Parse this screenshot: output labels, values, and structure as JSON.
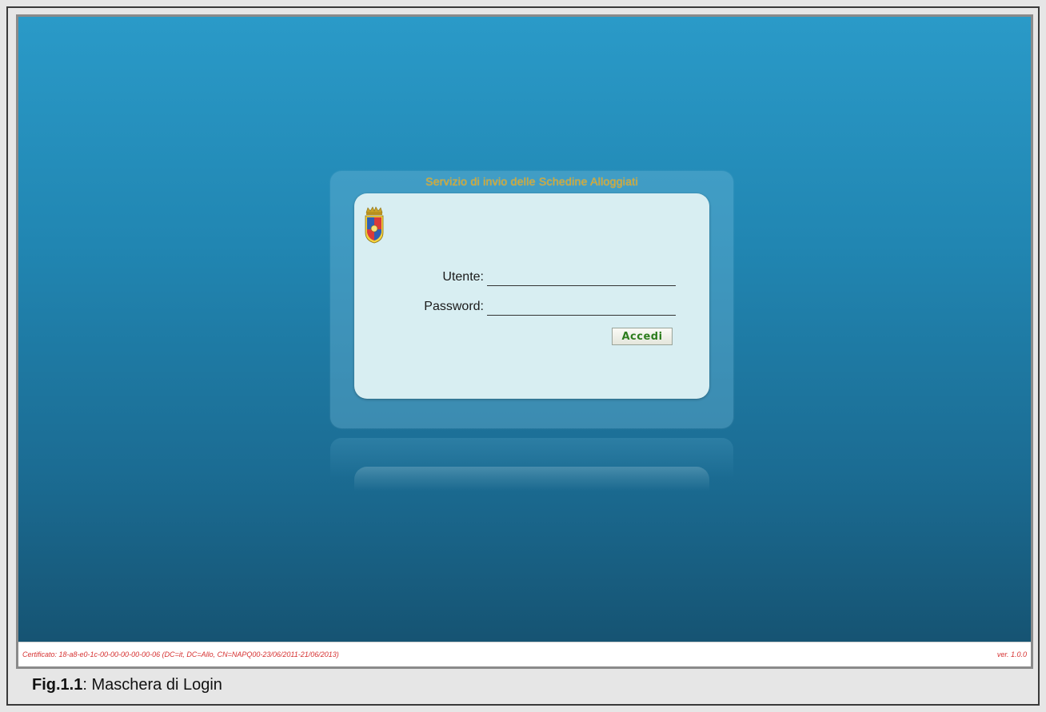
{
  "login": {
    "title": "Servizio di invio delle Schedine Alloggiati",
    "user_label": "Utente:",
    "user_value": "",
    "password_label": "Password:",
    "password_value": "",
    "submit_label": "Accedi"
  },
  "emblem_icon": "polizia-di-stato-emblem-icon",
  "status_bar": {
    "certificate": "Certificato: 18-a8-e0-1c-00-00-00-00-00-06 (DC=it, DC=Allo, CN=NAPQ00-23/06/2011-21/06/2013)",
    "version": "ver. 1.0.0"
  },
  "caption": {
    "figure_number": "Fig.1.1",
    "text": ": Maschera di Login"
  },
  "colors": {
    "background_top": "#2a9ac8",
    "background_bottom": "#15506e",
    "title": "#d6a52a",
    "panel": "#d8eef2",
    "status_text": "#d63030",
    "button_text": "#2e7d1e"
  }
}
